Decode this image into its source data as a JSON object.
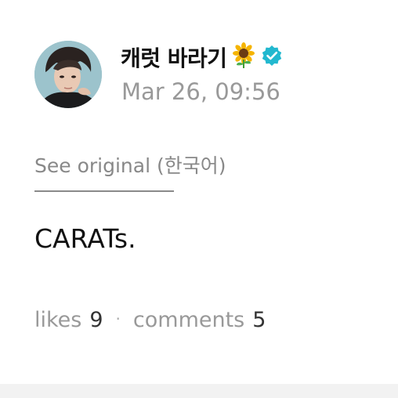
{
  "post": {
    "username": "캐럿 바라기",
    "username_emoji": "sunflower-icon",
    "verified_badge": "verified-icon",
    "timestamp": "Mar 26, 09:56",
    "see_original_label": "See original",
    "original_language": "(한국어)",
    "body_text": "CARATs.",
    "likes_label": "likes",
    "likes_count": "9",
    "separator": "·",
    "comments_label": "comments",
    "comments_count": "5"
  },
  "colors": {
    "verified": "#22b8cf",
    "text_primary": "#111111",
    "text_muted": "#999999"
  }
}
